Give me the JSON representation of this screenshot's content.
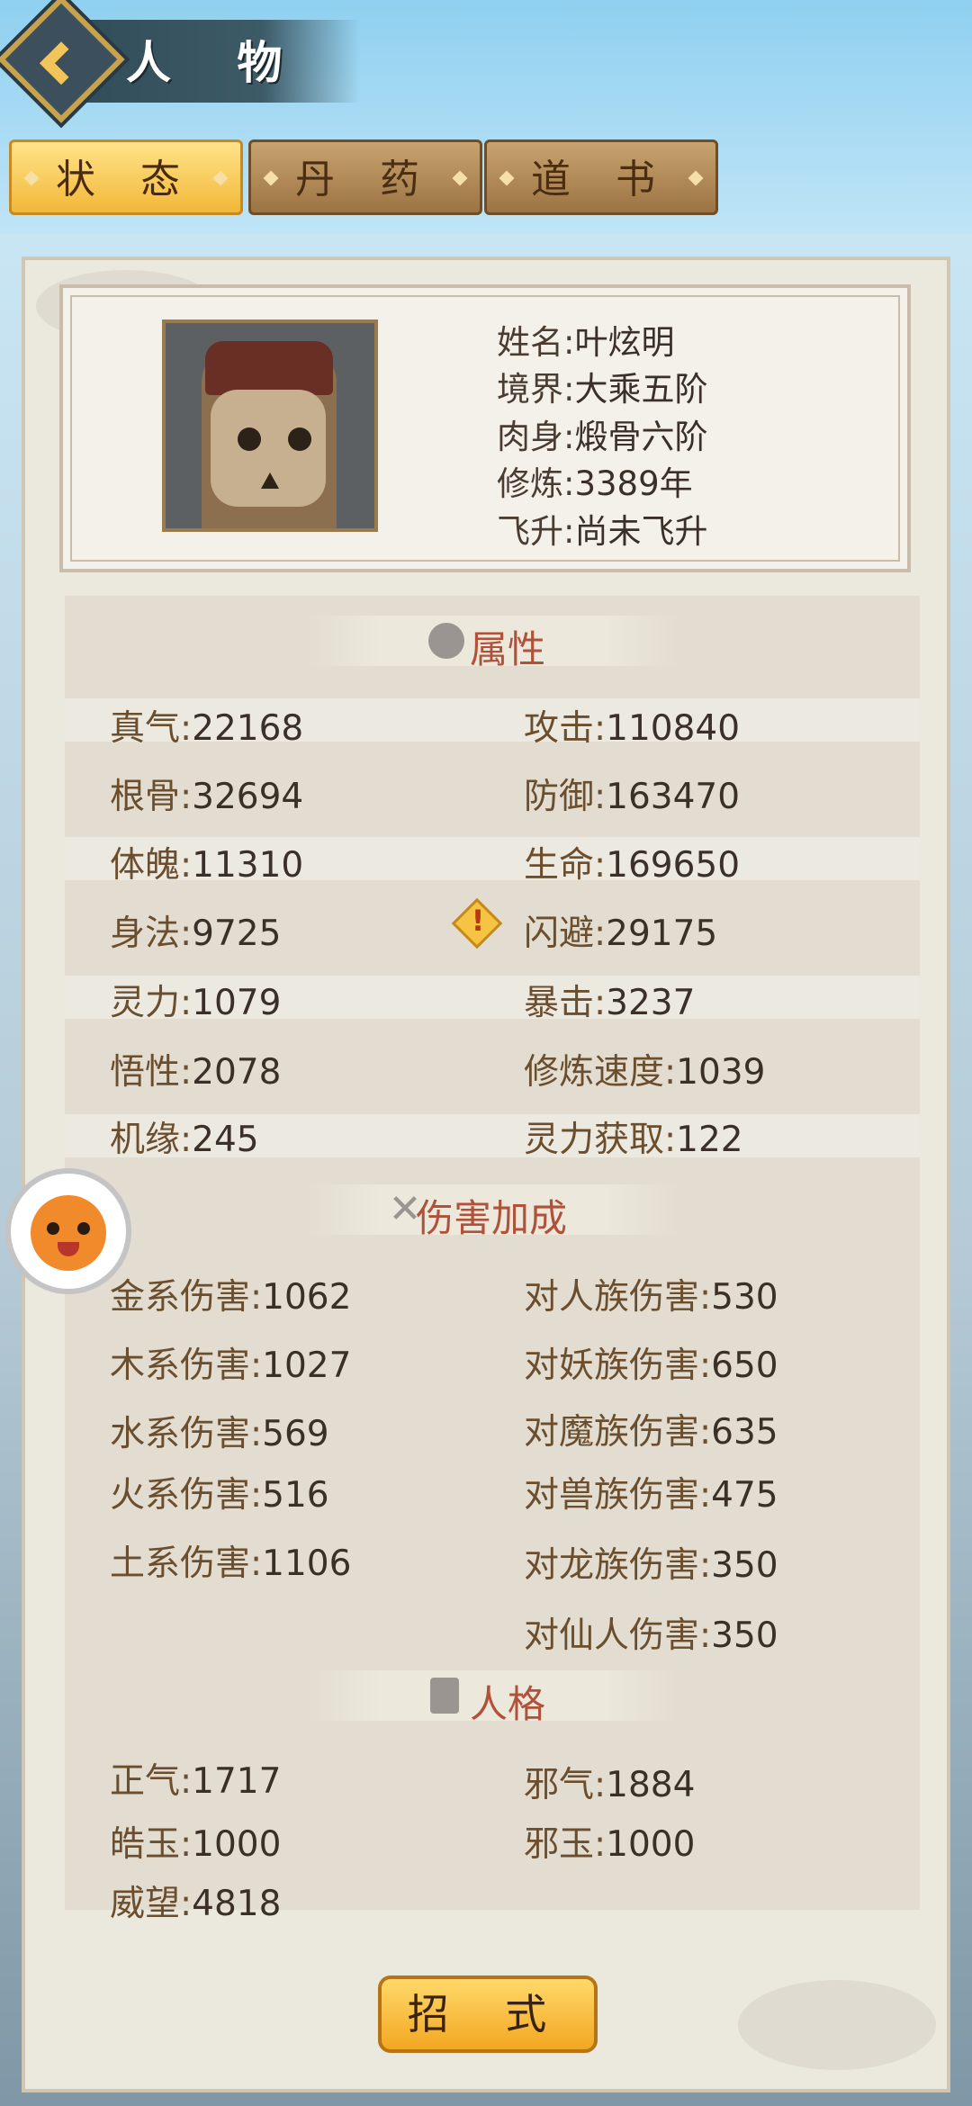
{
  "header": {
    "title": "人 物"
  },
  "tabs": [
    {
      "label": "状 态",
      "active": true
    },
    {
      "label": "丹 药",
      "active": false
    },
    {
      "label": "道 书",
      "active": false
    }
  ],
  "profile": {
    "rows": [
      {
        "key": "姓名:",
        "value": "叶炫明"
      },
      {
        "key": "境界:",
        "value": "大乘五阶"
      },
      {
        "key": "肉身:",
        "value": "煅骨六阶"
      },
      {
        "key": "修炼:",
        "value": "3389年"
      },
      {
        "key": "飞升:",
        "value": "尚未飞升"
      }
    ]
  },
  "sections": {
    "attributes": {
      "title": "属性",
      "left": [
        {
          "key": "真气:",
          "value": "22168"
        },
        {
          "key": "根骨:",
          "value": "32694"
        },
        {
          "key": "体魄:",
          "value": "11310"
        },
        {
          "key": "身法:",
          "value": "9725"
        },
        {
          "key": "灵力:",
          "value": "1079"
        },
        {
          "key": "悟性:",
          "value": "2078"
        },
        {
          "key": "机缘:",
          "value": "245"
        }
      ],
      "right": [
        {
          "key": "攻击:",
          "value": "110840"
        },
        {
          "key": "防御:",
          "value": "163470"
        },
        {
          "key": "生命:",
          "value": "169650"
        },
        {
          "key": "闪避:",
          "value": "29175"
        },
        {
          "key": "暴击:",
          "value": "3237"
        },
        {
          "key": "修炼速度:",
          "value": "1039"
        },
        {
          "key": "灵力获取:",
          "value": "122"
        }
      ]
    },
    "damage": {
      "title": "伤害加成",
      "left": [
        {
          "key": "金系伤害:",
          "value": "1062"
        },
        {
          "key": "木系伤害:",
          "value": "1027"
        },
        {
          "key": "水系伤害:",
          "value": "569"
        },
        {
          "key": "火系伤害:",
          "value": "516"
        },
        {
          "key": "土系伤害:",
          "value": "1106"
        }
      ],
      "right": [
        {
          "key": "对人族伤害:",
          "value": "530"
        },
        {
          "key": "对妖族伤害:",
          "value": "650"
        },
        {
          "key": "对魔族伤害:",
          "value": "635"
        },
        {
          "key": "对兽族伤害:",
          "value": "475"
        },
        {
          "key": "对龙族伤害:",
          "value": "350"
        },
        {
          "key": "对仙人伤害:",
          "value": "350"
        }
      ]
    },
    "personality": {
      "title": "人格",
      "left": [
        {
          "key": "正气:",
          "value": "1717"
        },
        {
          "key": "皓玉:",
          "value": "1000"
        },
        {
          "key": "威望:",
          "value": "4818"
        }
      ],
      "right": [
        {
          "key": "邪气:",
          "value": "1884"
        },
        {
          "key": "邪玉:",
          "value": "1000"
        }
      ]
    }
  },
  "bottom_button": {
    "label": "招 式"
  },
  "icons": {
    "back": "back-chevron-icon",
    "attributes": "yin-yang-icon",
    "damage": "crossed-swords-icon",
    "personality": "scroll-icon",
    "warning": "warning-diamond-icon",
    "pet": "pet-avatar-icon"
  },
  "colors": {
    "section_title": "#b0523a",
    "tab_active": "#f2b838",
    "tab_inactive": "#9c7444",
    "panel": "#ebe8de"
  }
}
